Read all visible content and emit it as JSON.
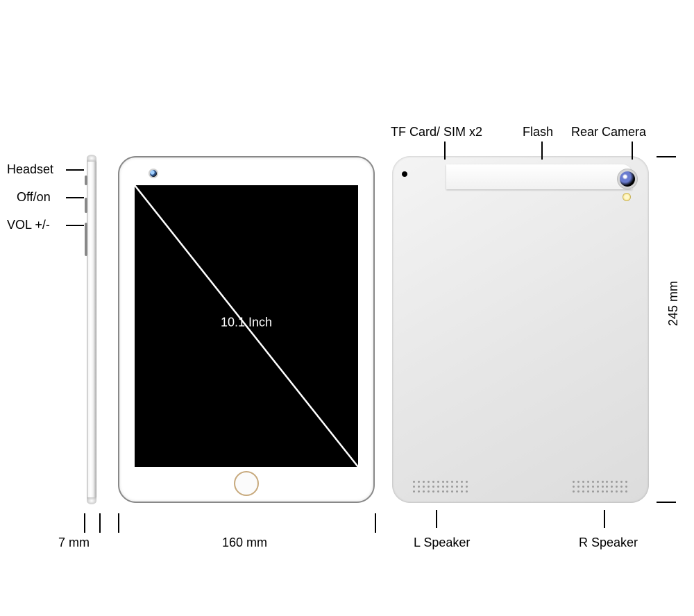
{
  "side_labels": {
    "headset": "Headset",
    "off_on": "Off/on",
    "vol": "VOL +/-"
  },
  "dimensions": {
    "thickness": "7 mm",
    "width": "160 mm",
    "height": "245 mm"
  },
  "screen": {
    "diagonal": "10.1 Inch"
  },
  "back_labels": {
    "tf_sim": "TF Card/ SIM x2",
    "flash": "Flash",
    "rear_cam": "Rear Camera",
    "l_speaker": "L Speaker",
    "r_speaker": "R Speaker"
  }
}
